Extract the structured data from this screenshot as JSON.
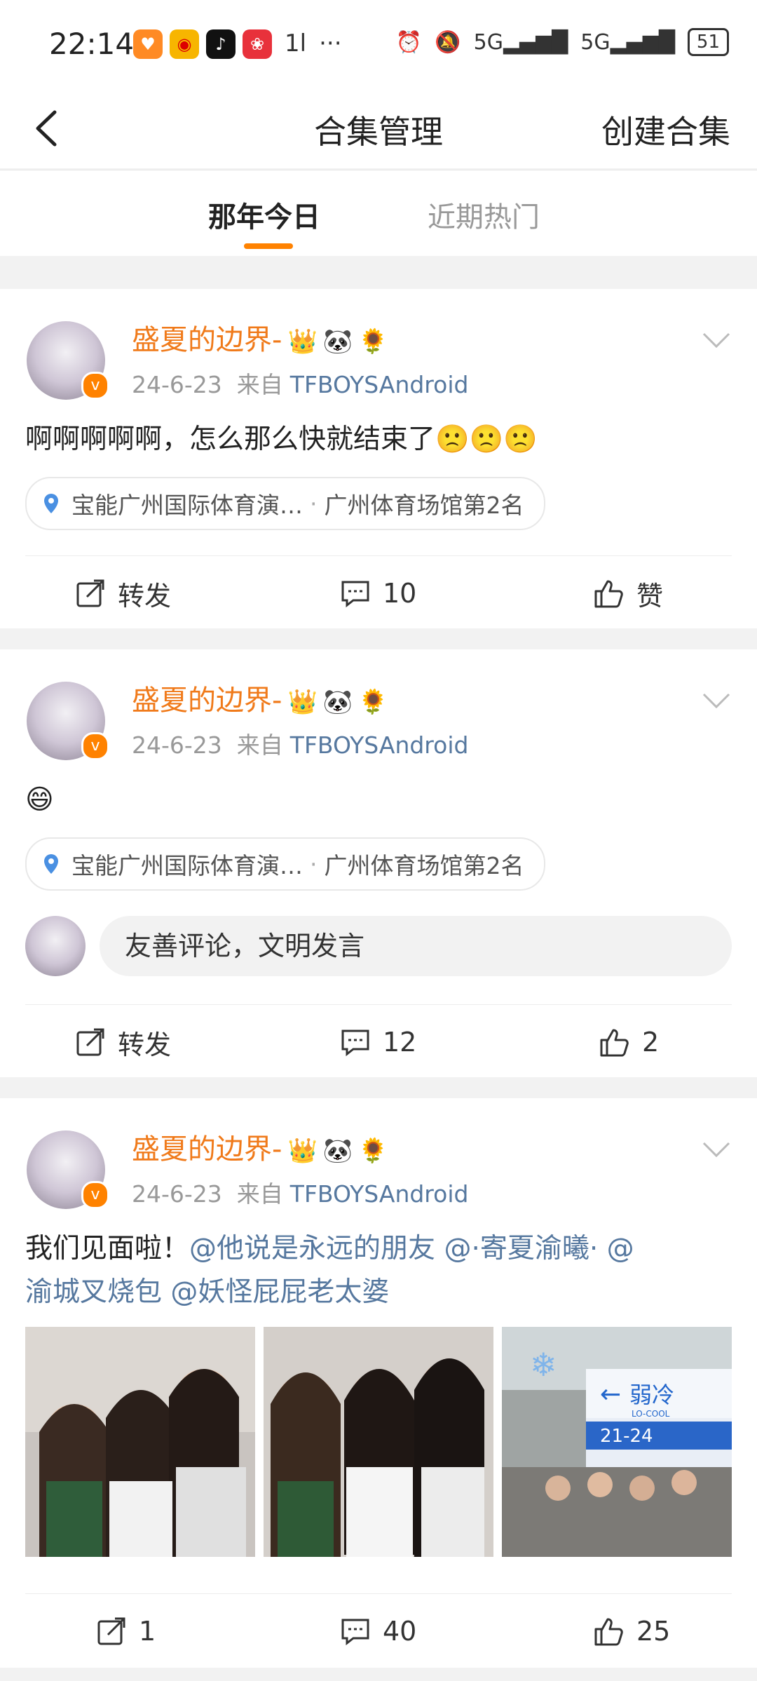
{
  "status_bar": {
    "time": "22:14",
    "signal_label": "1l",
    "more": "···",
    "net1": "5G",
    "net2": "5G",
    "battery": "51"
  },
  "header": {
    "title": "合集管理",
    "right_action": "创建合集"
  },
  "tabs": [
    {
      "label": "那年今日",
      "active": true
    },
    {
      "label": "近期热门",
      "active": false
    }
  ],
  "posts": [
    {
      "username": "盛夏的边界-",
      "emojis": [
        "👑",
        "🐼",
        "🌻"
      ],
      "date": "24-6-23",
      "source_prefix": "来自",
      "source": "TFBOYSAndroid",
      "text": "啊啊啊啊啊，怎么那么快就结束了🙁🙁🙁",
      "location": {
        "place": "宝能广州国际体育演…",
        "tag": "广州体育场馆第2名"
      },
      "actions": {
        "repost": "转发",
        "comments": "10",
        "like": "赞"
      }
    },
    {
      "username": "盛夏的边界-",
      "emojis": [
        "👑",
        "🐼",
        "🌻"
      ],
      "date": "24-6-23",
      "source_prefix": "来自",
      "source": "TFBOYSAndroid",
      "text": "😄",
      "location": {
        "place": "宝能广州国际体育演…",
        "tag": "广州体育场馆第2名"
      },
      "comment_placeholder": "友善评论，文明发言",
      "actions": {
        "repost": "转发",
        "comments": "12",
        "likes": "2"
      }
    },
    {
      "username": "盛夏的边界-",
      "emojis": [
        "👑",
        "🐼",
        "🌻"
      ],
      "date": "24-6-23",
      "source_prefix": "来自",
      "source": "TFBOYSAndroid",
      "text_plain": "我们见面啦！",
      "mentions": [
        "@他说是永远的朋友",
        "@·寄夏渝曦·",
        "@",
        "渝城叉烧包",
        "@妖怪屁屁老太婆"
      ],
      "photo_sign_1": "弱冷",
      "photo_sign_2": "LO-COOL",
      "photo_sign_3": "21-24",
      "actions": {
        "reposts": "1",
        "comments": "40",
        "likes": "25"
      }
    }
  ]
}
